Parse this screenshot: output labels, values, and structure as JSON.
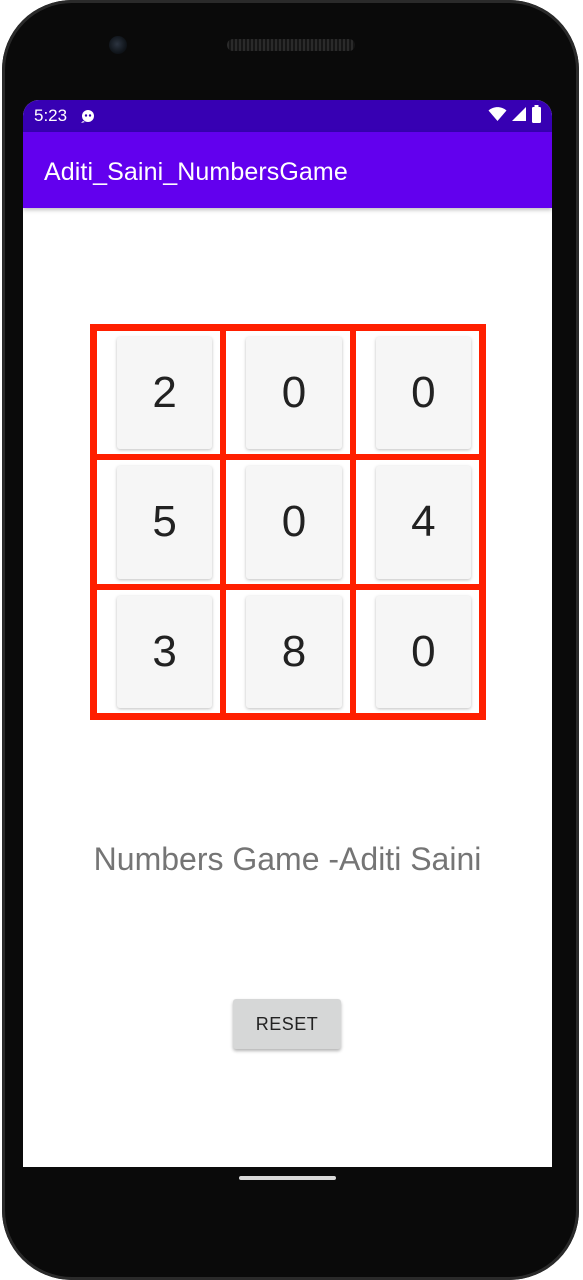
{
  "status_bar": {
    "time": "5:23",
    "notification_icon": "notification-icon",
    "icons": [
      "wifi-icon",
      "signal-icon",
      "battery-icon"
    ],
    "background": "#3700b3"
  },
  "app_bar": {
    "title": "Aditi_Saini_NumbersGame",
    "background": "#6200ee"
  },
  "grid": {
    "border_color": "#ff1f00",
    "tiles": [
      [
        "2",
        "0",
        "0"
      ],
      [
        "5",
        "0",
        "4"
      ],
      [
        "3",
        "8",
        "0"
      ]
    ]
  },
  "subtitle": "Numbers Game -Aditi Saini",
  "reset_label": "RESET"
}
